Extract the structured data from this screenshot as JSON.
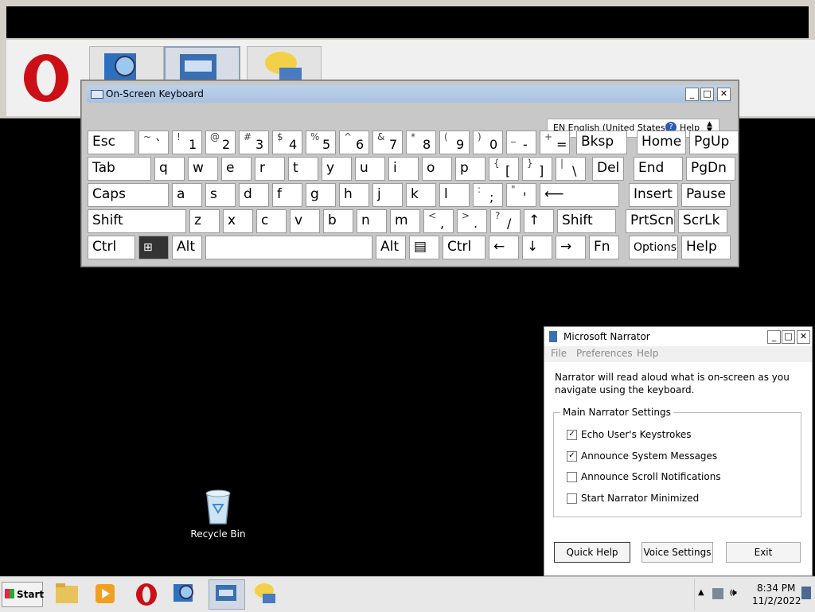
{
  "osk": {
    "title": "On-Screen Keyboard",
    "lang": "EN English (United States)",
    "help": "Help",
    "rows": [
      [
        {
          "label": "Esc"
        },
        {
          "shift": "~",
          "main": "`"
        },
        {
          "shift": "!",
          "main": "1"
        },
        {
          "shift": "@",
          "main": "2"
        },
        {
          "shift": "#",
          "main": "3"
        },
        {
          "shift": "$",
          "main": "4"
        },
        {
          "shift": "%",
          "main": "5"
        },
        {
          "shift": "^",
          "main": "6"
        },
        {
          "shift": "&",
          "main": "7"
        },
        {
          "shift": "*",
          "main": "8"
        },
        {
          "shift": "(",
          "main": "9"
        },
        {
          "shift": ")",
          "main": "0"
        },
        {
          "shift": "_",
          "main": "-"
        },
        {
          "shift": "+",
          "main": "="
        },
        {
          "label": "Bksp"
        },
        {
          "label": "Home"
        },
        {
          "label": "PgUp"
        }
      ],
      [
        {
          "label": "Tab"
        },
        {
          "label": "q"
        },
        {
          "label": "w"
        },
        {
          "label": "e"
        },
        {
          "label": "r"
        },
        {
          "label": "t"
        },
        {
          "label": "y"
        },
        {
          "label": "u"
        },
        {
          "label": "i"
        },
        {
          "label": "o"
        },
        {
          "label": "p"
        },
        {
          "shift": "{",
          "main": "["
        },
        {
          "shift": "}",
          "main": "]"
        },
        {
          "shift": "|",
          "main": "\\"
        },
        {
          "label": "Del"
        },
        {
          "label": "End"
        },
        {
          "label": "PgDn"
        }
      ],
      [
        {
          "label": "Caps"
        },
        {
          "label": "a"
        },
        {
          "label": "s"
        },
        {
          "label": "d"
        },
        {
          "label": "f"
        },
        {
          "label": "g"
        },
        {
          "label": "h"
        },
        {
          "label": "j"
        },
        {
          "label": "k"
        },
        {
          "label": "l"
        },
        {
          "shift": ":",
          "main": ";"
        },
        {
          "shift": "\"",
          "main": "'"
        },
        {
          "label": "⟵"
        },
        {
          "label": "Insert"
        },
        {
          "label": "Pause"
        }
      ],
      [
        {
          "label": "Shift"
        },
        {
          "label": "z"
        },
        {
          "label": "x"
        },
        {
          "label": "c"
        },
        {
          "label": "v"
        },
        {
          "label": "b"
        },
        {
          "label": "n"
        },
        {
          "label": "m"
        },
        {
          "shift": "<",
          "main": ","
        },
        {
          "shift": ">",
          "main": "."
        },
        {
          "shift": "?",
          "main": "/"
        },
        {
          "label": "↑"
        },
        {
          "label": "Shift"
        },
        {
          "label": "PrtScn"
        },
        {
          "label": "ScrLk"
        }
      ],
      [
        {
          "label": "Ctrl"
        },
        {
          "label": ""
        },
        {
          "label": "Alt"
        },
        {
          "label": ""
        },
        {
          "label": "Alt"
        },
        {
          "label": "▤"
        },
        {
          "label": "Ctrl"
        },
        {
          "label": "←"
        },
        {
          "label": "↓"
        },
        {
          "label": "→"
        },
        {
          "label": "Fn"
        },
        {
          "label": "Options"
        },
        {
          "label": "Help"
        }
      ]
    ]
  },
  "narrator": {
    "title": "Microsoft Narrator",
    "menu": [
      "File",
      "Preferences",
      "Help"
    ],
    "description": "Narrator will read aloud what is on-screen as you navigate using the keyboard.",
    "group_title": "Main Narrator Settings",
    "options": [
      {
        "label": "Echo User's Keystrokes",
        "checked": true
      },
      {
        "label": "Announce System Messages",
        "checked": true
      },
      {
        "label": "Announce Scroll Notifications",
        "checked": false
      },
      {
        "label": "Start Narrator Minimized",
        "checked": false
      }
    ],
    "buttons": {
      "quick_help": "Quick Help",
      "voice_settings": "Voice Settings",
      "exit": "Exit"
    }
  },
  "desktop": {
    "recycle_bin": "Recycle Bin"
  },
  "taskbar": {
    "start": "Start",
    "time": "8:34 PM",
    "date": "11/2/2022"
  },
  "colors": {
    "opera_red": "#cc0f16",
    "title_blue": "#b3cbe6"
  }
}
